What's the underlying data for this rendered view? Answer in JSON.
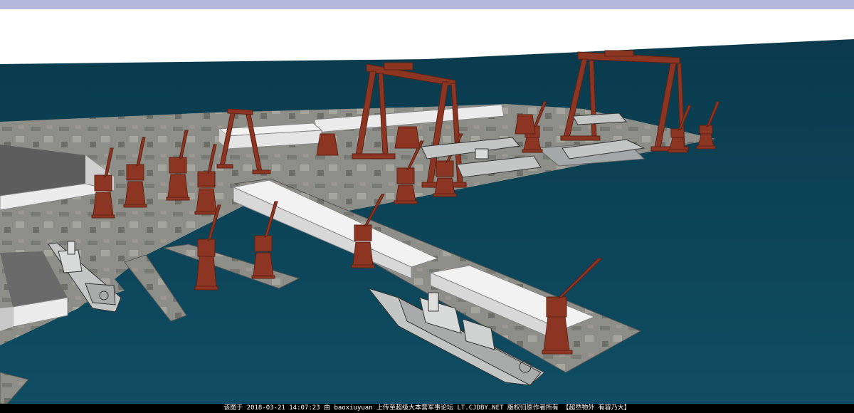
{
  "watermark": "该图于 2018-03-21 14:07:23 由 baoxiuyuan 上传至超级大本营军事论坛 LT.CJDBY.NET 版权归原作者所有 【超然物外 有容乃大】",
  "colors": {
    "sky": "#ffffff",
    "title_bar": "#b4b8dc",
    "sea": "#0f4d63",
    "sea_dark": "#0a3a4c",
    "ground": "#8e8e88",
    "crane": "#8c3522",
    "crane_dark": "#5e2215",
    "building_roof": "#ececec",
    "building_side": "#c9c9c9",
    "ship_hull": "#c4c6c6",
    "ship_deck": "#a9abab",
    "footer_bg": "#000000",
    "footer_text": "#ffffff"
  }
}
